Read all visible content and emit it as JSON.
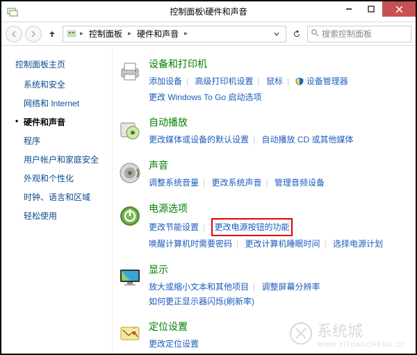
{
  "window": {
    "title": "控制面板\\硬件和声音"
  },
  "breadcrumb": {
    "root": "控制面板",
    "current": "硬件和声音"
  },
  "search": {
    "placeholder": "搜索控制面板"
  },
  "sidebar": {
    "heading": "控制面板主页",
    "items": [
      {
        "label": "系统和安全"
      },
      {
        "label": "网络和 Internet"
      },
      {
        "label": "硬件和声音",
        "current": true
      },
      {
        "label": "程序"
      },
      {
        "label": "用户帐户和家庭安全"
      },
      {
        "label": "外观和个性化"
      },
      {
        "label": "时钟、语言和区域"
      },
      {
        "label": "轻松使用"
      }
    ]
  },
  "categories": [
    {
      "id": "devices",
      "title": "设备和打印机",
      "links": [
        "添加设备",
        "高级打印机设置",
        "鼠标"
      ],
      "shielded": "设备管理器",
      "sub": [
        "更改 Windows To Go 启动选项"
      ]
    },
    {
      "id": "autoplay",
      "title": "自动播放",
      "links": [
        "更改媒体或设备的默认设置",
        "自动播放 CD 或其他媒体"
      ]
    },
    {
      "id": "sound",
      "title": "声音",
      "links": [
        "调整系统音量",
        "更改系统声音",
        "管理音频设备"
      ]
    },
    {
      "id": "power",
      "title": "电源选项",
      "links": [
        "更改节能设置"
      ],
      "highlight": "更改电源按钮的功能",
      "sub": [
        "唤醒计算机时需要密码",
        "更改计算机睡眠时间",
        "选择电源计划"
      ]
    },
    {
      "id": "display",
      "title": "显示",
      "links": [
        "放大或缩小文本和其他项目",
        "调整屏幕分辨率"
      ],
      "sub": [
        "如何更正显示器闪烁(刷新率)"
      ]
    },
    {
      "id": "location",
      "title": "定位设置",
      "links": [
        "更改定位设置"
      ]
    }
  ],
  "watermark": {
    "line1": "系统城",
    "line2": "WWW.XITONGCHENG.CC"
  }
}
